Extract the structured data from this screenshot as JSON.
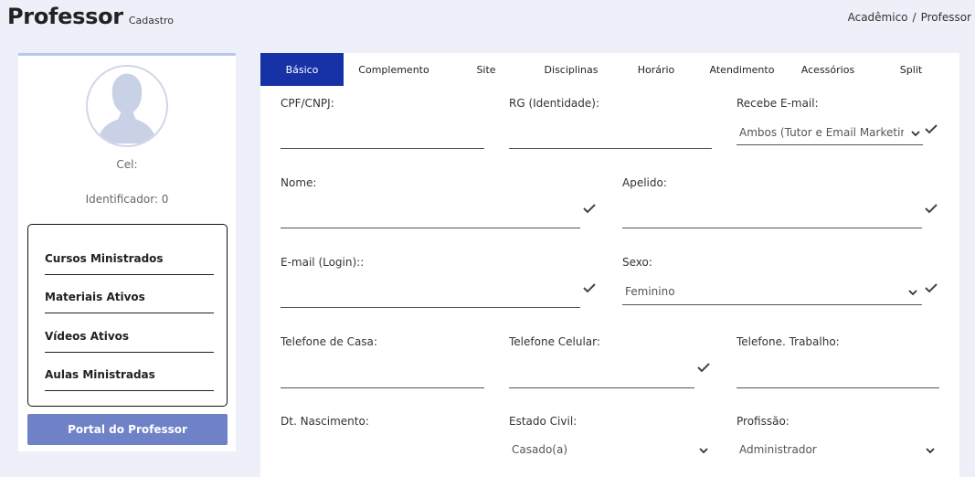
{
  "header": {
    "title": "Professor",
    "subtitle": "Cadastro"
  },
  "breadcrumb": {
    "items": [
      "Acadêmico",
      "Professor"
    ],
    "separator": "/"
  },
  "profile": {
    "cel_label": "Cel:",
    "identifier_label": "Identificador: 0",
    "stats": [
      "Cursos Ministrados",
      "Materiais Ativos",
      "Vídeos Ativos",
      "Aulas Ministradas"
    ],
    "portal_button": "Portal do Professor"
  },
  "tabs": [
    "Básico",
    "Complemento",
    "Site",
    "Disciplinas",
    "Horário",
    "Atendimento",
    "Acessórios",
    "Split"
  ],
  "active_tab": "Básico",
  "form": {
    "cpf_label": "CPF/CNPJ:",
    "rg_label": "RG (Identidade):",
    "recebe_email_label": "Recebe E-mail:",
    "recebe_email_value": "Ambos (Tutor e Email Marketing)",
    "nome_label": "Nome:",
    "apelido_label": "Apelido:",
    "email_label": "E-mail (Login)::",
    "sexo_label": "Sexo:",
    "sexo_value": "Feminino",
    "tel_casa_label": "Telefone de Casa:",
    "tel_celular_label": "Telefone Celular:",
    "tel_trabalho_label": "Telefone. Trabalho:",
    "dt_nasc_label": "Dt. Nascimento:",
    "estado_civil_label": "Estado Civil:",
    "estado_civil_value": "Casado(a)",
    "profissao_label": "Profissão:",
    "profissao_value": "Administrador"
  },
  "colors": {
    "accent": "#1632a6",
    "portal_button": "#6f82c8",
    "background": "#eef0f9"
  }
}
